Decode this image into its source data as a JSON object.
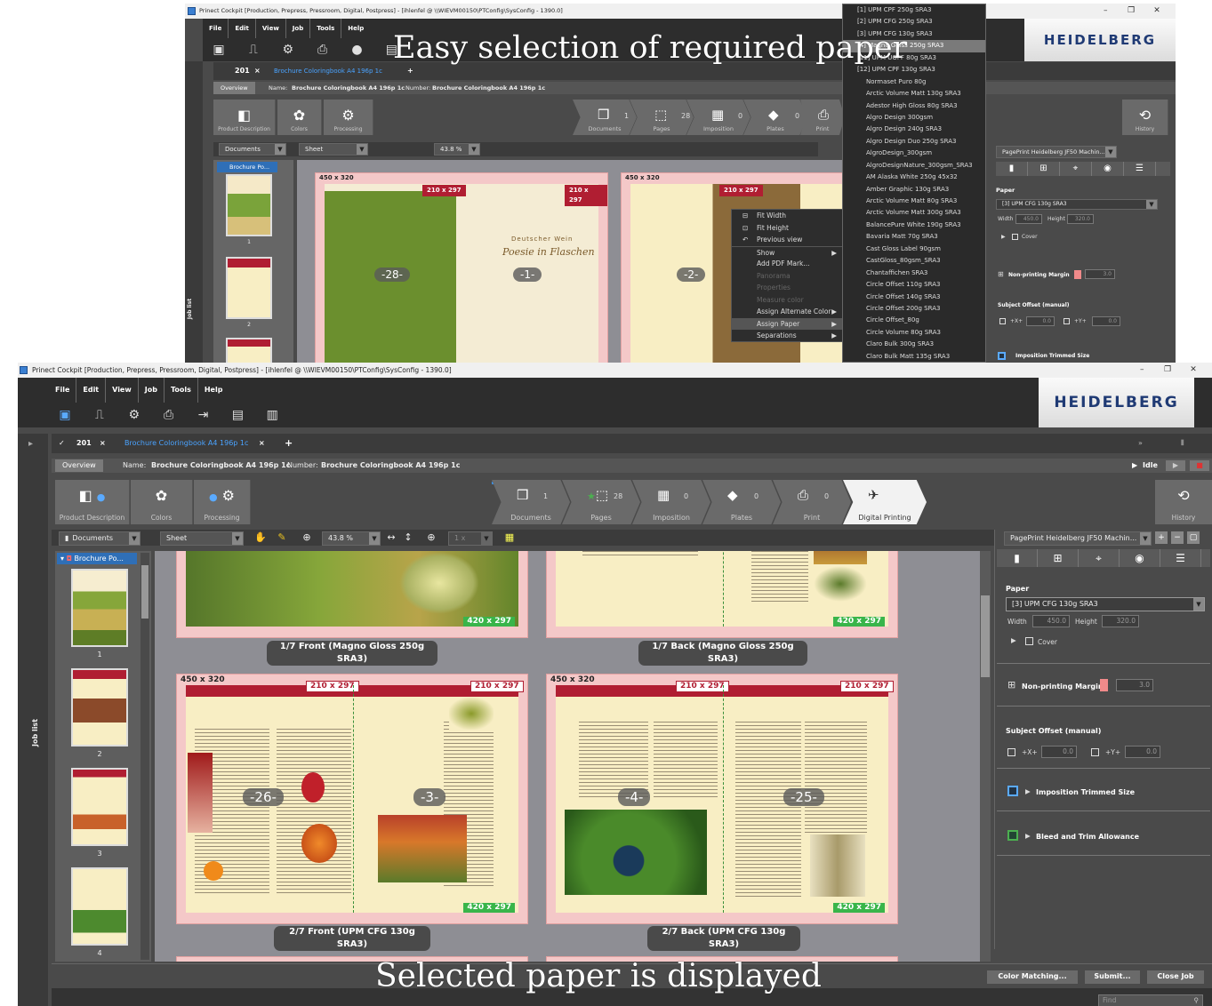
{
  "window": {
    "title": "Prinect Cockpit [Production, Prepress, Pressroom, Digital, Postpress] - [ihlenfel @ \\\\WIEVM00150\\PTConfig\\SysConfig - 1390.0]",
    "minimize": "–",
    "maximize": "❐",
    "close": "✕"
  },
  "menu": [
    "File",
    "Edit",
    "View",
    "Job",
    "Tools",
    "Help"
  ],
  "brand": "HEIDELBERG",
  "job_tab": {
    "number": "201",
    "close": "×",
    "doc": "Brochure Coloringbook A4 196p 1c",
    "add": "+",
    "expand": "»"
  },
  "overview": {
    "tab": "Overview",
    "name_label": "Name:",
    "name_value": "Brochure Coloringbook A4 196p 1c",
    "number_label": "Number:",
    "number_value": "Brochure Coloringbook A4 196p 1c",
    "status": "Idle"
  },
  "left_steps": [
    "Product Description",
    "Colors",
    "Processing"
  ],
  "workflow": [
    {
      "label": "Documents",
      "count": "1"
    },
    {
      "label": "Pages",
      "count": "28"
    },
    {
      "label": "Imposition",
      "count": "0"
    },
    {
      "label": "Plates",
      "count": "0"
    },
    {
      "label": "Print",
      "count": "0"
    },
    {
      "label": "Digital Printing",
      "count": ""
    }
  ],
  "history_label": "History",
  "toolbar": {
    "documents": "Documents",
    "sheet": "Sheet",
    "zoom": "43.8 %",
    "one_x": "1 x"
  },
  "tree_item": "Brochure Po...",
  "job_list": "Job list",
  "thumb_numbers": [
    "1",
    "2",
    "3",
    "4"
  ],
  "sheets": [
    {
      "size": "",
      "half": "420 x 297",
      "caption": "1/7 Front (Magno Gloss 250g SRA3)"
    },
    {
      "size": "",
      "half": "420 x 297",
      "caption": "1/7 Back (Magno Gloss 250g SRA3)"
    },
    {
      "size": "450 x 320",
      "left_tag": "210 x 297",
      "right_tag": "210 x 297",
      "half": "420 x 297",
      "pages": [
        "-26-",
        "-3-"
      ],
      "caption": "2/7 Front (UPM CFG 130g SRA3)"
    },
    {
      "size": "450 x 320",
      "left_tag": "210 x 297",
      "right_tag": "210 x 297",
      "half": "420 x 297",
      "pages": [
        "-4-",
        "-25-"
      ],
      "caption": "2/7 Back (UPM CFG 130g SRA3)"
    }
  ],
  "top_sheets": [
    {
      "size": "450 x 320",
      "left_tag": "210 x 297",
      "right_tag": "210 x 297",
      "pages": [
        "-28-",
        "-1-"
      ],
      "script1": "Deutscher Wein",
      "script2": "Poesie in Flaschen"
    },
    {
      "size": "450 x 320",
      "left_tag": "210 x 297",
      "pages": [
        "-2-"
      ]
    }
  ],
  "right_panel": {
    "device": "PagePrint Heidelberg JF50 Machin...",
    "paper_label": "Paper",
    "paper_value": "[3] UPM CFG 130g SRA3",
    "width_label": "Width",
    "width_value": "450.0",
    "height_label": "Height",
    "height_value": "320.0",
    "cover": "Cover",
    "non_printing_margin": "Non-printing Margin",
    "margin_value": "3.0",
    "subject_offset": "Subject Offset (manual)",
    "x_label": "+X+",
    "x_value": "0.0",
    "y_label": "+Y+",
    "y_value": "0.0",
    "imposition_trimmed": "Imposition Trimmed Size",
    "bleed_trim": "Bleed and Trim Allowance"
  },
  "context_menu": [
    {
      "label": "Fit Width",
      "icon": "⊟"
    },
    {
      "label": "Fit Height",
      "icon": "⊡"
    },
    {
      "label": "Previous view",
      "icon": "↶"
    },
    {
      "label": "Show",
      "arrow": "▶"
    },
    {
      "label": "Add PDF Mark..."
    },
    {
      "label": "Panorama",
      "disabled": true
    },
    {
      "label": "Properties",
      "disabled": true
    },
    {
      "label": "Measure color",
      "disabled": true
    },
    {
      "label": "Assign Alternate Color",
      "arrow": "▶"
    },
    {
      "label": "Assign Paper",
      "arrow": "▶",
      "selected": true
    },
    {
      "label": "Separations",
      "arrow": "▶"
    }
  ],
  "paper_list": [
    "[1] UPM CPF 250g SRA3",
    "[2] UPM CFG 250g SRA3",
    "[3] UPM CFG 130g SRA3",
    "[4] Magno Gloss 250g SRA3",
    "[11] UPM UOFF 80g SRA3",
    "[12] UPM CPF 130g SRA3",
    "Normaset Puro 80g",
    "Arctic Volume Matt 130g SRA3",
    "Adestor High Gloss 80g SRA3",
    "Algro Design 300gsm",
    "Algro Design 240g SRA3",
    "Algro Design Duo 250g SRA3",
    "AlgroDesign_300gsm",
    "AlgroDesignNature_300gsm_SRA3",
    "AM Alaska White 250g 45x32",
    "Amber Graphic 130g SRA3",
    "Arctic Volume Matt 80g SRA3",
    "Arctic Volume Matt 300g SRA3",
    "BalancePure White 190g SRA3",
    "Bavaria Matt 70g SRA3",
    "Cast Gloss Label 90gsm",
    "CastGloss_80gsm_SRA3",
    "Chantaffichen SRA3",
    "Circle Offset 110g SRA3",
    "Circle Offset 140g SRA3",
    "Circle Offset 200g SRA3",
    "Circle Offset_80g",
    "Circle Volume 80g SRA3",
    "Claro Bulk 300g SRA3",
    "Claro Bulk Matt 135g SRA3"
  ],
  "headline_top": "Easy selection of required paper",
  "headline_bottom": "Selected paper is displayed",
  "bottom_buttons": [
    "Color Matching...",
    "Submit...",
    "Close Job"
  ],
  "find_placeholder": "Find",
  "colors": {
    "accent": "#4aa3ff",
    "sheet_band": "#b01e32",
    "half_tag": "#39b54a"
  }
}
